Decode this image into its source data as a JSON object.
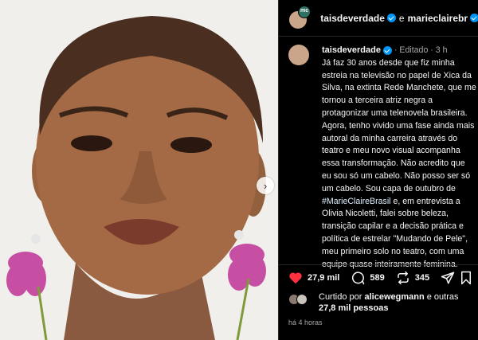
{
  "header": {
    "user1": "taisdeverdade",
    "connector": "e",
    "user2": "marieclairebr"
  },
  "caption": {
    "username": "taisdeverdade",
    "meta": "· Editado · 3 h",
    "text_before": "Já faz 30 anos desde que fiz minha estreia na televisão no papel de Xica da Silva, na extinta Rede Manchete, que me tornou a terceira atriz negra a protagonizar uma telenovela brasileira. Agora, tenho vivido uma fase ainda mais autoral da minha carreira através do teatro e meu novo visual acompanha essa transformação. Não acredito que eu sou só um cabelo. Não posso ser só um cabelo. Sou capa de outubro de ",
    "hashtag": "#MarieClaireBrasil",
    "text_after": " e, em entrevista a Olivia Nicoletti, falei sobre beleza, transição capilar e a decisão prática e política de estrelar \"Mudando de Pele\", meu primeiro solo no teatro, com uma equipe quase inteiramente feminina."
  },
  "actions": {
    "likes": "27,9 mil",
    "comments": "589",
    "reposts": "345"
  },
  "liked_by": {
    "prefix": "Curtido por",
    "user": "alicewegmann",
    "connector": "e outras",
    "count": "27,8 mil pessoas"
  },
  "timestamp": "há 4 horas",
  "icons": {
    "verified": "verified-badge-icon",
    "like": "heart-icon",
    "comment": "comment-icon",
    "repost": "repost-icon",
    "share": "share-icon",
    "save": "bookmark-icon",
    "next": "chevron-right-icon"
  },
  "colors": {
    "like": "#ff3040",
    "verified": "#0095f6",
    "hashtag": "#e0f1ff"
  }
}
